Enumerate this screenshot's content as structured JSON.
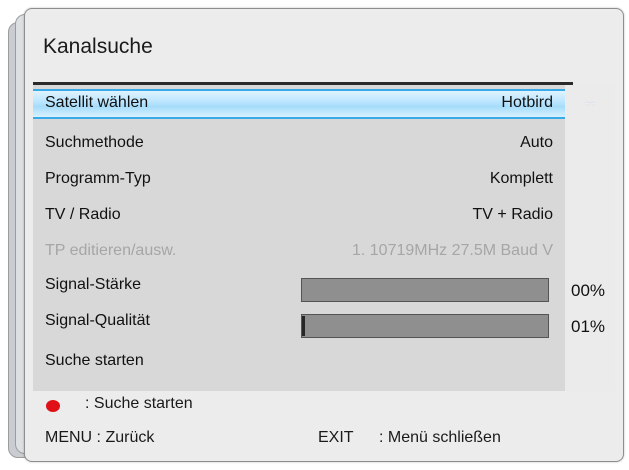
{
  "dialog": {
    "title": "Kanalsuche"
  },
  "menu": [
    {
      "label": "Satellit wählen",
      "value": "Hotbird",
      "state": "selected"
    },
    {
      "label": "Suchmethode",
      "value": "Auto",
      "state": "normal"
    },
    {
      "label": "Programm-Typ",
      "value": "Komplett",
      "state": "normal"
    },
    {
      "label": "TV / Radio",
      "value": "TV + Radio",
      "state": "normal"
    },
    {
      "label": "TP editieren/ausw.",
      "value": "1. 10719MHz 27.5M Baud V",
      "state": "disabled"
    },
    {
      "label": "Signal-Stärke",
      "percent_text": "00%",
      "level_fraction": 0.0
    },
    {
      "label": "Signal-Qualität",
      "percent_text": "01%",
      "level_fraction": 0.01
    },
    {
      "label": "Suche starten"
    }
  ],
  "side_icon": {
    "name": "left-right-arrow-icon",
    "glyph": "↔"
  },
  "footer": {
    "red_button_hint": ": Suche starten",
    "menu_hint": "MENU : Zurück",
    "exit_key": "EXIT",
    "exit_hint": ": Menü schließen"
  },
  "colors": {
    "selection_highlight": "#a5dcfa",
    "selection_border": "#3aa9e8",
    "red_key": "#e01017",
    "disabled_text": "#a6a6a6"
  }
}
